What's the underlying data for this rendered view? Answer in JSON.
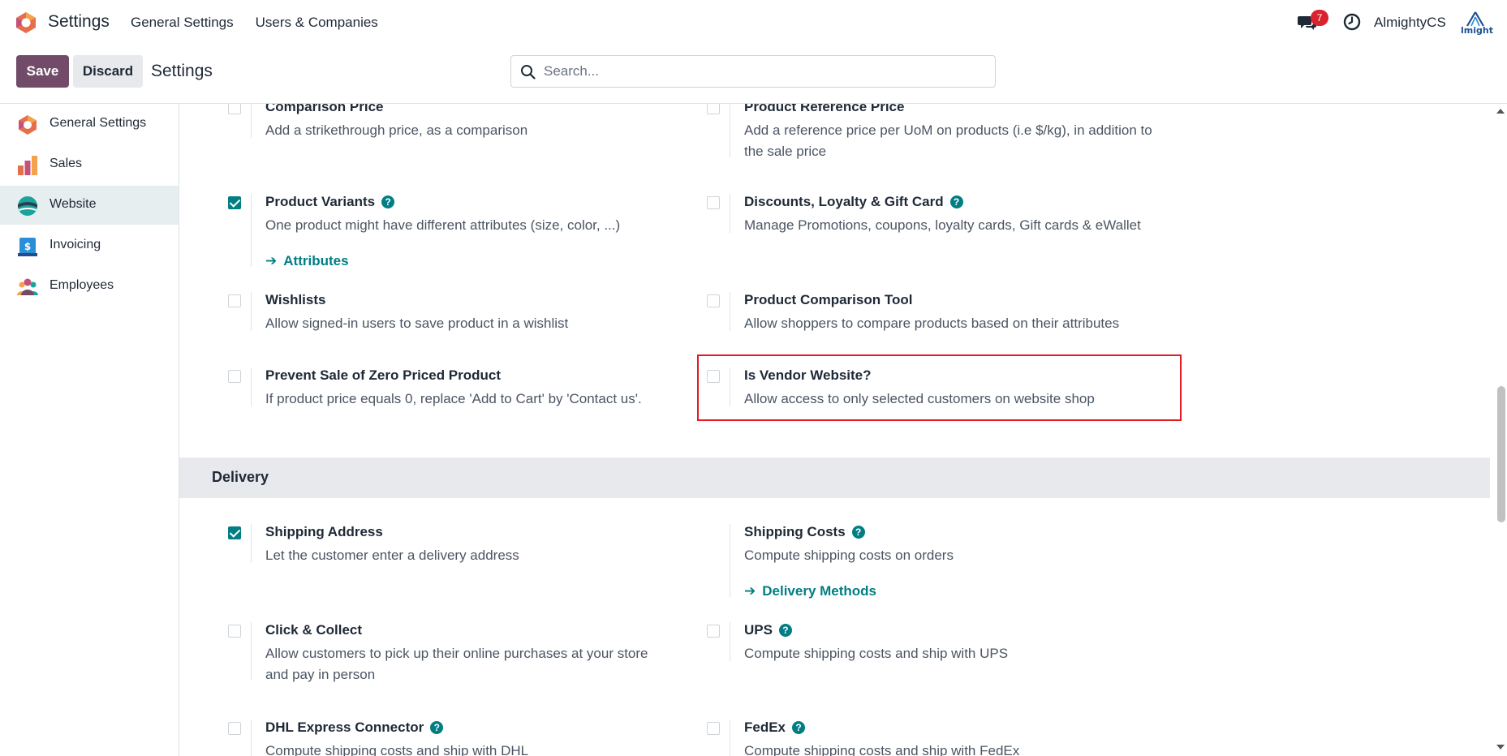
{
  "header": {
    "app_name": "Settings",
    "menu": [
      "General Settings",
      "Users & Companies"
    ],
    "chat_badge_count": "7",
    "user_name": "AlmightyCS",
    "company_logo_text": "lmight"
  },
  "control_panel": {
    "save_label": "Save",
    "discard_label": "Discard",
    "breadcrumb": "Settings",
    "search_placeholder": "Search..."
  },
  "sidebar": {
    "items": [
      {
        "label": "General Settings",
        "icon": "odoo-logo-icon"
      },
      {
        "label": "Sales",
        "icon": "sales-chart-icon"
      },
      {
        "label": "Website",
        "icon": "website-globe-icon",
        "active": true
      },
      {
        "label": "Invoicing",
        "icon": "invoice-dollar-icon"
      },
      {
        "label": "Employees",
        "icon": "employees-people-icon"
      }
    ]
  },
  "settings": {
    "comparison_price": {
      "title": "Comparison Price",
      "desc": "Add a strikethrough price, as a comparison",
      "checked": false
    },
    "product_reference_price": {
      "title": "Product Reference Price",
      "desc": "Add a reference price per UoM on products (i.e $/kg), in addition to the sale price",
      "checked": false
    },
    "product_variants": {
      "title": "Product Variants",
      "desc": "One product might have different attributes (size, color, ...)",
      "link": "Attributes",
      "checked": true
    },
    "discounts": {
      "title": "Discounts, Loyalty & Gift Card",
      "desc": "Manage Promotions, coupons, loyalty cards, Gift cards & eWallet",
      "checked": false
    },
    "wishlists": {
      "title": "Wishlists",
      "desc": "Allow signed-in users to save product in a wishlist",
      "checked": false
    },
    "comparison_tool": {
      "title": "Product Comparison Tool",
      "desc": "Allow shoppers to compare products based on their attributes",
      "checked": false
    },
    "prevent_zero": {
      "title": "Prevent Sale of Zero Priced Product",
      "desc": "If product price equals 0, replace 'Add to Cart' by 'Contact us'.",
      "checked": false
    },
    "vendor_website": {
      "title": "Is Vendor Website?",
      "desc": "Allow access to only selected customers on website shop",
      "checked": false
    }
  },
  "delivery": {
    "section_title": "Delivery",
    "shipping_address": {
      "title": "Shipping Address",
      "desc": "Let the customer enter a delivery address",
      "checked": true
    },
    "shipping_costs": {
      "title": "Shipping Costs",
      "desc": "Compute shipping costs on orders",
      "link": "Delivery Methods"
    },
    "click_collect": {
      "title": "Click & Collect",
      "desc": "Allow customers to pick up their online purchases at your store and pay in person",
      "checked": false
    },
    "ups": {
      "title": "UPS",
      "desc": "Compute shipping costs and ship with UPS",
      "checked": false
    },
    "dhl": {
      "title": "DHL Express Connector",
      "desc": "Compute shipping costs and ship with DHL",
      "checked": false
    },
    "fedex": {
      "title": "FedEx",
      "desc": "Compute shipping costs and ship with FedEx",
      "checked": false
    }
  },
  "colors": {
    "primary": "#714b67",
    "accent": "#017e84",
    "highlight": "#e31b23",
    "badge": "#d9232e"
  }
}
